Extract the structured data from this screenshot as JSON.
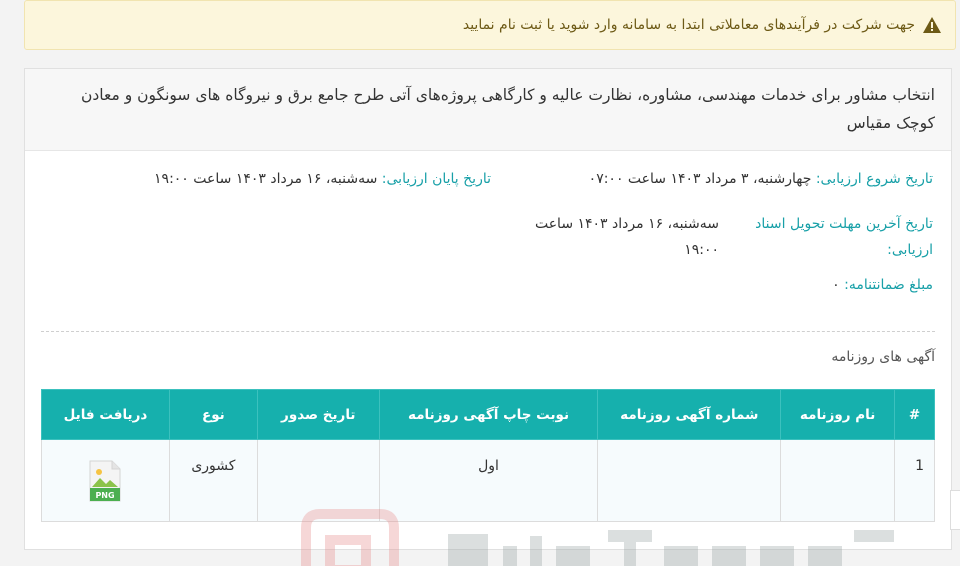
{
  "alert": {
    "text": "جهت شرکت در فرآیندهای معاملاتی ابتدا به سامانه وارد شوید یا ثبت نام نمایید"
  },
  "tender": {
    "title": "انتخاب مشاور برای خدمات مهندسی، مشاوره، نظارت عالیه و کارگاهی پروژه‌های آتی طرح جامع برق و نیروگاه های سونگون و معادن کوچک مقیاس"
  },
  "details": {
    "start_label": "تاریخ شروع ارزیابی:",
    "start_value": "چهارشنبه، ۳ مرداد ۱۴۰۳ ساعت ۰۷:۰۰",
    "end_label": "تاریخ پایان ارزیابی:",
    "end_value": "سه‌شنبه، ۱۶ مرداد ۱۴۰۳ ساعت ۱۹:۰۰",
    "deadline_label_line1": "تاریخ آخرین مهلت تحویل اسناد",
    "deadline_label_line2": "ارزیابی:",
    "deadline_value_line1": "سه‌شنبه، ۱۶ مرداد ۱۴۰۳ ساعت",
    "deadline_value_line2": "۱۹:۰۰",
    "guarantee_label": "مبلغ ضمانتنامه:",
    "guarantee_value": "۰"
  },
  "news_section": {
    "title": "آگهی های روزنامه",
    "columns": {
      "num": "#",
      "newspaper": "نام روزنامه",
      "ad_number": "شماره آگهی روزنامه",
      "print_turn": "نوبت چاپ آگهی روزنامه",
      "issue_date": "تاریخ صدور",
      "type": "نوع",
      "download": "دریافت فایل"
    },
    "rows": [
      {
        "num": "1",
        "newspaper": "",
        "ad_number": "",
        "print_turn": "اول",
        "issue_date": "",
        "type": "کشوری",
        "file_type": "PNG"
      }
    ]
  },
  "colors": {
    "accent": "#16b0ad",
    "label": "#18a0a8",
    "alert_bg": "#fcf6dc"
  },
  "icons": {
    "alert": "warning-icon",
    "file": "png-file-icon"
  }
}
